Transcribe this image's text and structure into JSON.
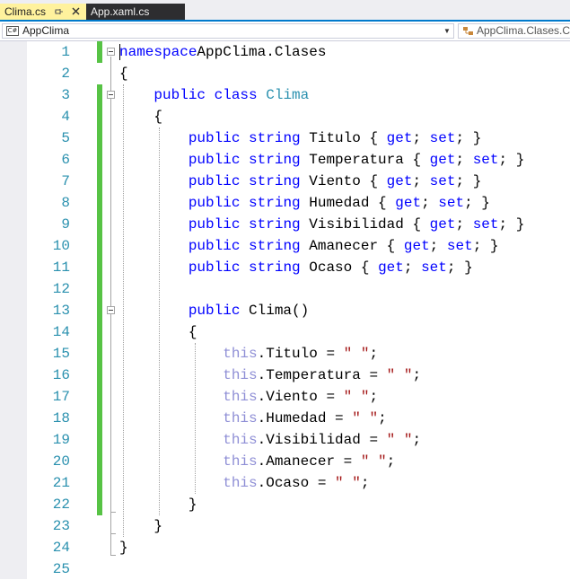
{
  "tabs": [
    {
      "label": "Clima.cs",
      "active": true
    },
    {
      "label": "App.xaml.cs",
      "active": false
    }
  ],
  "navbar": {
    "project_icon_text": "C#",
    "project": "AppClima",
    "member": "AppClima.Clases.Clima"
  },
  "colors": {
    "keyword": "#0000ff",
    "type": "#2b91af",
    "string": "#a31515",
    "this_keyword": "#8f8fd6",
    "line_number": "#2b91af",
    "change_bar": "#57c345",
    "active_tab": "#fff29d",
    "accent": "#007acc"
  },
  "lines": [
    [
      [
        "kw",
        "namespace"
      ],
      [
        "",
        "AppClima.Clases"
      ]
    ],
    [
      [
        "",
        "{"
      ]
    ],
    [
      [
        "",
        "    "
      ],
      [
        "kw",
        "public"
      ],
      [
        "",
        " "
      ],
      [
        "kw",
        "class"
      ],
      [
        "",
        " "
      ],
      [
        "ty",
        "Clima"
      ]
    ],
    [
      [
        "",
        "    {"
      ]
    ],
    [
      [
        "",
        "        "
      ],
      [
        "kw",
        "public"
      ],
      [
        "",
        " "
      ],
      [
        "kw",
        "string"
      ],
      [
        "",
        " Titulo { "
      ],
      [
        "kw",
        "get"
      ],
      [
        "",
        "; "
      ],
      [
        "kw",
        "set"
      ],
      [
        "",
        "; }"
      ]
    ],
    [
      [
        "",
        "        "
      ],
      [
        "kw",
        "public"
      ],
      [
        "",
        " "
      ],
      [
        "kw",
        "string"
      ],
      [
        "",
        " Temperatura { "
      ],
      [
        "kw",
        "get"
      ],
      [
        "",
        "; "
      ],
      [
        "kw",
        "set"
      ],
      [
        "",
        "; }"
      ]
    ],
    [
      [
        "",
        "        "
      ],
      [
        "kw",
        "public"
      ],
      [
        "",
        " "
      ],
      [
        "kw",
        "string"
      ],
      [
        "",
        " Viento { "
      ],
      [
        "kw",
        "get"
      ],
      [
        "",
        "; "
      ],
      [
        "kw",
        "set"
      ],
      [
        "",
        "; }"
      ]
    ],
    [
      [
        "",
        "        "
      ],
      [
        "kw",
        "public"
      ],
      [
        "",
        " "
      ],
      [
        "kw",
        "string"
      ],
      [
        "",
        " Humedad { "
      ],
      [
        "kw",
        "get"
      ],
      [
        "",
        "; "
      ],
      [
        "kw",
        "set"
      ],
      [
        "",
        "; }"
      ]
    ],
    [
      [
        "",
        "        "
      ],
      [
        "kw",
        "public"
      ],
      [
        "",
        " "
      ],
      [
        "kw",
        "string"
      ],
      [
        "",
        " Visibilidad { "
      ],
      [
        "kw",
        "get"
      ],
      [
        "",
        "; "
      ],
      [
        "kw",
        "set"
      ],
      [
        "",
        "; }"
      ]
    ],
    [
      [
        "",
        "        "
      ],
      [
        "kw",
        "public"
      ],
      [
        "",
        " "
      ],
      [
        "kw",
        "string"
      ],
      [
        "",
        " Amanecer { "
      ],
      [
        "kw",
        "get"
      ],
      [
        "",
        "; "
      ],
      [
        "kw",
        "set"
      ],
      [
        "",
        "; }"
      ]
    ],
    [
      [
        "",
        "        "
      ],
      [
        "kw",
        "public"
      ],
      [
        "",
        " "
      ],
      [
        "kw",
        "string"
      ],
      [
        "",
        " Ocaso { "
      ],
      [
        "kw",
        "get"
      ],
      [
        "",
        "; "
      ],
      [
        "kw",
        "set"
      ],
      [
        "",
        "; }"
      ]
    ],
    [
      [
        "",
        ""
      ]
    ],
    [
      [
        "",
        "        "
      ],
      [
        "kw",
        "public"
      ],
      [
        "",
        " Clima()"
      ]
    ],
    [
      [
        "",
        "        {"
      ]
    ],
    [
      [
        "",
        "            "
      ],
      [
        "th",
        "this"
      ],
      [
        "",
        ".Titulo = "
      ],
      [
        "str",
        "\" \""
      ],
      [
        "",
        ";"
      ]
    ],
    [
      [
        "",
        "            "
      ],
      [
        "th",
        "this"
      ],
      [
        "",
        ".Temperatura = "
      ],
      [
        "str",
        "\" \""
      ],
      [
        "",
        ";"
      ]
    ],
    [
      [
        "",
        "            "
      ],
      [
        "th",
        "this"
      ],
      [
        "",
        ".Viento = "
      ],
      [
        "str",
        "\" \""
      ],
      [
        "",
        ";"
      ]
    ],
    [
      [
        "",
        "            "
      ],
      [
        "th",
        "this"
      ],
      [
        "",
        ".Humedad = "
      ],
      [
        "str",
        "\" \""
      ],
      [
        "",
        ";"
      ]
    ],
    [
      [
        "",
        "            "
      ],
      [
        "th",
        "this"
      ],
      [
        "",
        ".Visibilidad = "
      ],
      [
        "str",
        "\" \""
      ],
      [
        "",
        ";"
      ]
    ],
    [
      [
        "",
        "            "
      ],
      [
        "th",
        "this"
      ],
      [
        "",
        ".Amanecer = "
      ],
      [
        "str",
        "\" \""
      ],
      [
        "",
        ";"
      ]
    ],
    [
      [
        "",
        "            "
      ],
      [
        "th",
        "this"
      ],
      [
        "",
        ".Ocaso = "
      ],
      [
        "str",
        "\" \""
      ],
      [
        "",
        ";"
      ]
    ],
    [
      [
        "",
        "        }"
      ]
    ],
    [
      [
        "",
        "    }"
      ]
    ],
    [
      [
        "",
        "}"
      ]
    ],
    [
      [
        "",
        ""
      ]
    ]
  ],
  "changed_lines": [
    1,
    3,
    4,
    5,
    6,
    7,
    8,
    9,
    10,
    11,
    12,
    13,
    14,
    15,
    16,
    17,
    18,
    19,
    20,
    21,
    22
  ],
  "fold_lines": [
    1,
    3,
    13
  ]
}
